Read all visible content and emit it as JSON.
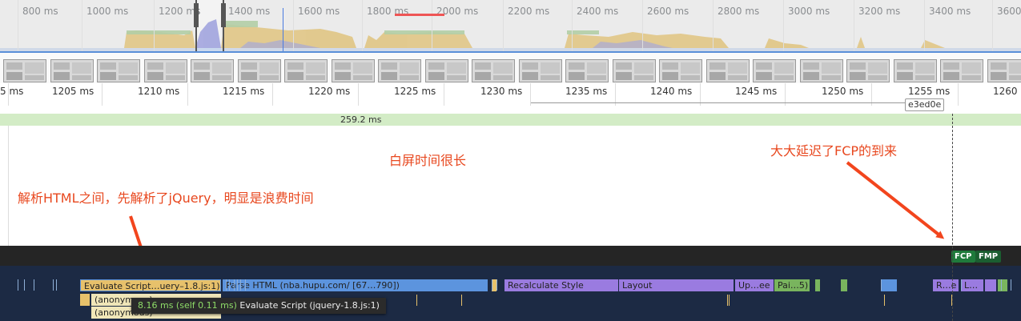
{
  "overview": {
    "labels": [
      "800 ms",
      "1000 ms",
      "1200 ms",
      "1400 ms",
      "1600 ms",
      "1800 ms",
      "2000 ms",
      "2200 ms",
      "2400 ms",
      "2600 ms",
      "2800 ms",
      "3000 ms",
      "3200 ms",
      "3400 ms",
      "3600 ms"
    ]
  },
  "ruler": {
    "labels": [
      "5 ms",
      "1205 ms",
      "1210 ms",
      "1215 ms",
      "1220 ms",
      "1225 ms",
      "1230 ms",
      "1235 ms",
      "1240 ms",
      "1245 ms",
      "1250 ms",
      "1255 ms",
      "1260 ms"
    ],
    "marker_tag": "e3ed0e"
  },
  "duration": {
    "label": "259.2 ms"
  },
  "annotations": {
    "white_screen": "白屏时间很长",
    "delay_fcp": "大大延迟了FCP的到来",
    "parse_jquery": "解析HTML之间，先解析了jQuery，明显是浪费时间"
  },
  "timings": {
    "fcp": "FCP",
    "fmp": "FMP"
  },
  "thread": {
    "evaluate_script": "Evaluate Script…uery–1.8.js:1)",
    "parse_html": "Parse HTML (nba.hupu.com/ [67…790])",
    "recalc_style": "Recalculate Style",
    "layout": "Layout",
    "update": "Up…ee",
    "paint": "Pai…5)",
    "recalc_short": "R…e",
    "layout_short": "L…",
    "anon1": "(anonymous)",
    "anon2": "(anonymous)"
  },
  "tooltip": {
    "time": "8.16 ms (self 0.11 ms)",
    "text": "Evaluate Script (jquery-1.8.js:1)"
  },
  "colors": {
    "script": "#e7c16b",
    "parse": "#5c94de",
    "rendering": "#9a7be0",
    "painting": "#79b45e",
    "fcp": "#1f7a3b"
  }
}
